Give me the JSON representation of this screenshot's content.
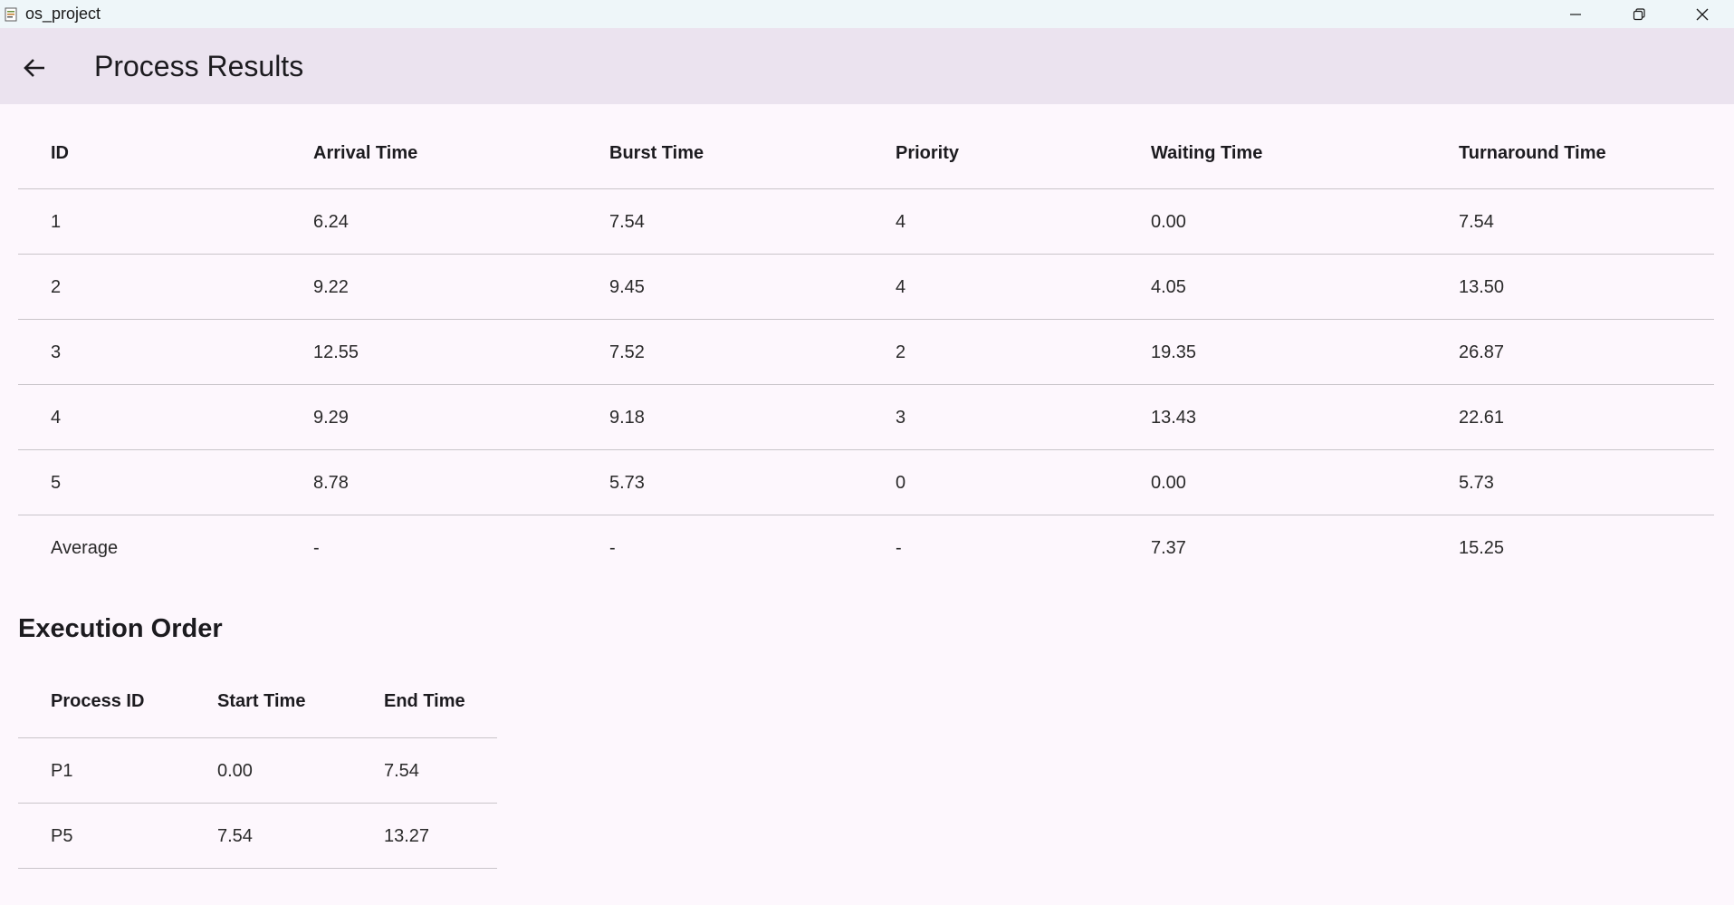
{
  "window": {
    "title": "os_project"
  },
  "appbar": {
    "title": "Process Results"
  },
  "results": {
    "headers": [
      "ID",
      "Arrival Time",
      "Burst Time",
      "Priority",
      "Waiting Time",
      "Turnaround Time"
    ],
    "rows": [
      [
        "1",
        "6.24",
        "7.54",
        "4",
        "0.00",
        "7.54"
      ],
      [
        "2",
        "9.22",
        "9.45",
        "4",
        "4.05",
        "13.50"
      ],
      [
        "3",
        "12.55",
        "7.52",
        "2",
        "19.35",
        "26.87"
      ],
      [
        "4",
        "9.29",
        "9.18",
        "3",
        "13.43",
        "22.61"
      ],
      [
        "5",
        "8.78",
        "5.73",
        "0",
        "0.00",
        "5.73"
      ],
      [
        "Average",
        "-",
        "-",
        "-",
        "7.37",
        "15.25"
      ]
    ]
  },
  "execution": {
    "title": "Execution Order",
    "headers": [
      "Process ID",
      "Start Time",
      "End Time"
    ],
    "rows": [
      [
        "P1",
        "0.00",
        "7.54"
      ],
      [
        "P5",
        "7.54",
        "13.27"
      ]
    ]
  }
}
